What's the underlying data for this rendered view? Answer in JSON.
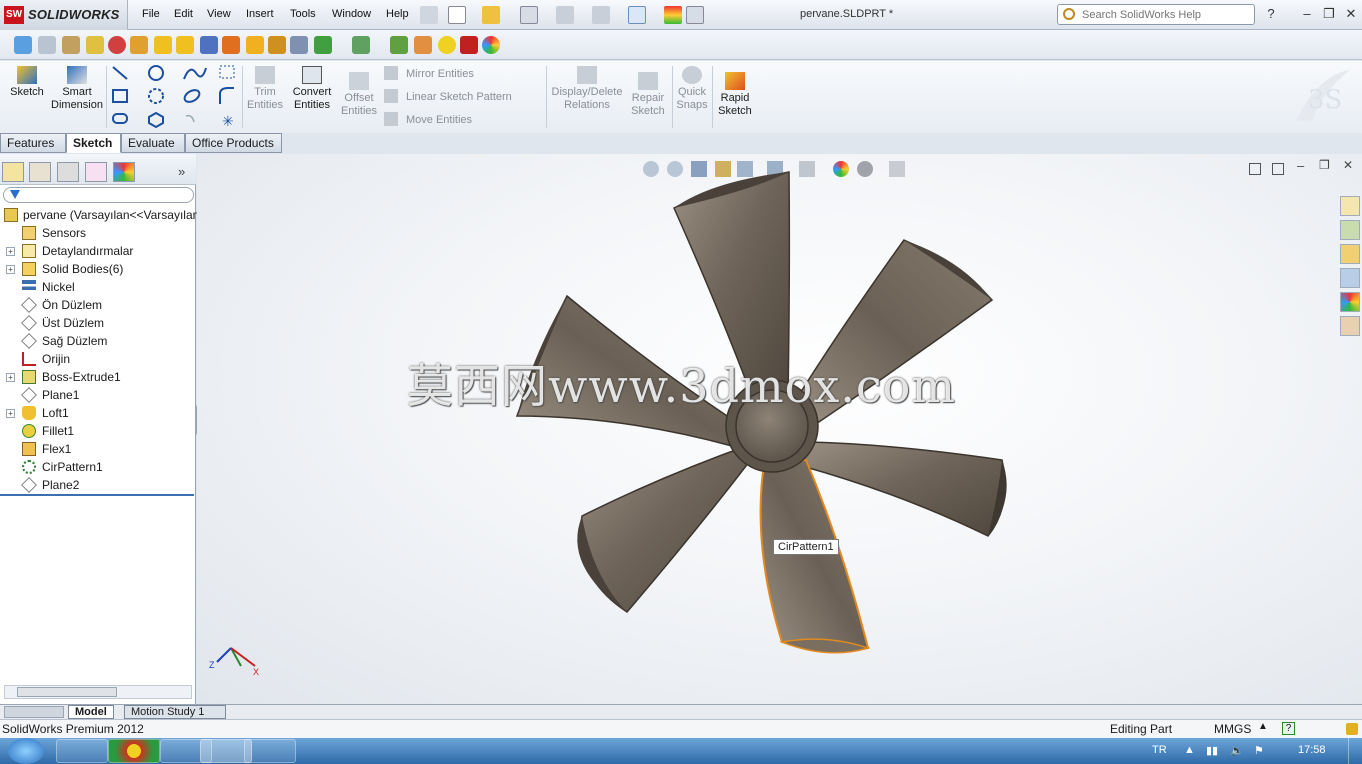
{
  "app": {
    "logo_text": "SOLIDWORKS",
    "doc_title": "pervane.SLDPRT *",
    "help_search_placeholder": "Search SolidWorks Help"
  },
  "menu": [
    "File",
    "Edit",
    "View",
    "Insert",
    "Tools",
    "Window",
    "Help"
  ],
  "command_manager": {
    "sketch": "Sketch",
    "smart_dimension": [
      "Smart",
      "Dimension"
    ],
    "trim": [
      "Trim",
      "Entities"
    ],
    "convert": [
      "Convert",
      "Entities"
    ],
    "offset": [
      "Offset",
      "Entities"
    ],
    "mirror": "Mirror Entities",
    "linear_pattern": "Linear Sketch Pattern",
    "move": "Move Entities",
    "display_delete": [
      "Display/Delete",
      "Relations"
    ],
    "repair": [
      "Repair",
      "Sketch"
    ],
    "quick_snaps": [
      "Quick",
      "Snaps"
    ],
    "rapid_sketch": [
      "Rapid",
      "Sketch"
    ]
  },
  "tabs": [
    "Features",
    "Sketch",
    "Evaluate",
    "Office Products"
  ],
  "active_tab": "Sketch",
  "tree": {
    "root": "pervane  (Varsayılan<<Varsayılan",
    "items": [
      {
        "label": "Sensors",
        "icon": "sensor-icon",
        "expandable": false
      },
      {
        "label": "Detaylandırmalar",
        "icon": "annotations-icon",
        "expandable": true
      },
      {
        "label": "Solid Bodies(6)",
        "icon": "solid-bodies-icon",
        "expandable": true
      },
      {
        "label": "Nickel",
        "icon": "material-icon",
        "expandable": false
      },
      {
        "label": "Ön Düzlem",
        "icon": "plane-icon",
        "expandable": false
      },
      {
        "label": "Üst Düzlem",
        "icon": "plane-icon",
        "expandable": false
      },
      {
        "label": "Sağ Düzlem",
        "icon": "plane-icon",
        "expandable": false
      },
      {
        "label": "Orijin",
        "icon": "origin-icon",
        "expandable": false
      },
      {
        "label": "Boss-Extrude1",
        "icon": "extrude-icon",
        "expandable": true
      },
      {
        "label": "Plane1",
        "icon": "plane-icon",
        "expandable": false
      },
      {
        "label": "Loft1",
        "icon": "loft-icon",
        "expandable": true
      },
      {
        "label": "Fillet1",
        "icon": "fillet-icon",
        "expandable": false
      },
      {
        "label": "Flex1",
        "icon": "flex-icon",
        "expandable": false
      },
      {
        "label": "CirPattern1",
        "icon": "circular-pattern-icon",
        "expandable": false
      },
      {
        "label": "Plane2",
        "icon": "plane-icon",
        "expandable": false
      }
    ]
  },
  "graphics": {
    "callout": "CirPattern1",
    "watermark": "莫西网www.3dmox.com",
    "triad": {
      "x": "X",
      "z": "Z"
    }
  },
  "bottom_tabs": [
    "Model",
    "Motion Study 1"
  ],
  "status": {
    "left": "SolidWorks Premium 2012",
    "mode": "Editing Part",
    "units": "MMGS"
  },
  "taskbar": {
    "lang": "TR",
    "time": "17:58"
  }
}
